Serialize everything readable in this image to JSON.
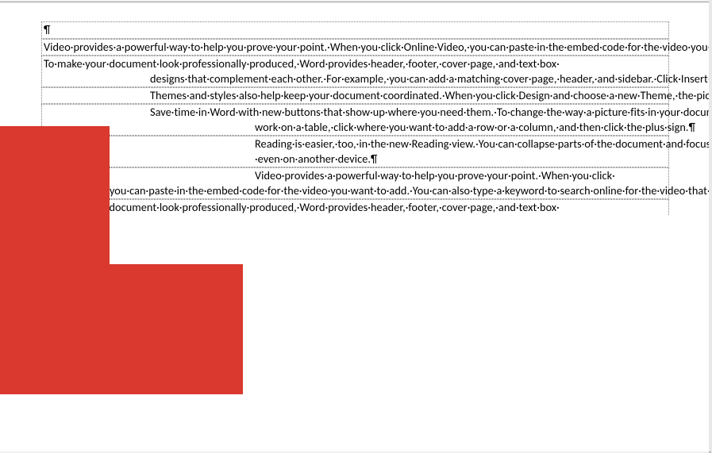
{
  "formatting_marks": {
    "pilcrow": "¶",
    "space_dot": "·"
  },
  "shapes": [
    {
      "type": "rectangle",
      "color": "#d9392e",
      "role": "floating-object"
    }
  ],
  "paragraphs": [
    {
      "id": "empty",
      "text": "",
      "mark": "¶"
    },
    {
      "id": "p1",
      "text": "Video·provides·a·powerful·way·to·help·you·prove·your·point.·When·you·click·Online·Video,·you·can·paste·in·the·embed·code·for·the·video·you·want·to·add.·You·can·also·type·a·keyword·to·search·online·for·the·video·that·best·fits·your·document.¶"
    },
    {
      "id": "p2_a",
      "text": "To·make·your·document·look·professionally·produced,·Word·provides·header,·footer,·cover·page,·and·text·box·"
    },
    {
      "id": "p2_b",
      "text": "designs·that·complement·each·other.·For·example,·you·can·add·a·matching·cover·page,·header,·and·sidebar.·Click·Insert·and·then·choose·the·elements·you·want·from·the·different·galleries.¶"
    },
    {
      "id": "p3",
      "text": "Themes·and·styles·also·help·keep·your·document·coordinated.·When·you·click·Design·and·choose·a·new·Theme,·the·pictures,·charts,·and·SmartArt·graphics·change·to·match·your·new·theme.·When·you·apply·styles,·your·headings·change·to·match·the·new·theme.¶"
    },
    {
      "id": "p4_a",
      "text": "Save·time·in·Word·with·new·buttons·that·show·up·where·you·need·them.·To·change·the·way·a·picture·fits·in·your·document,·click·it·and·a·button·for·layout·options·appears·next·to·it.·When·you·"
    },
    {
      "id": "p4_b",
      "text": "work·on·a·table,·click·where·you·want·to·add·a·row·or·a·column,·and·then·click·the·plus·sign.¶"
    },
    {
      "id": "p5",
      "text": "Reading·is·easier,·too,·in·the·new·Reading·view.·You·can·collapse·parts·of·the·document·and·focus·on·the·text·you·want.·If·you·need·to·stop·reading·before·you·reach·the·end,·Word·remembers·where·you·left·off·-·even·on·another·device.¶"
    },
    {
      "id": "p6_a",
      "text": "Video·provides·a·powerful·way·to·help·you·prove·your·point.·When·you·click·"
    },
    {
      "id": "p6_b",
      "text": "Online·Video,·you·can·paste·in·the·embed·code·for·the·video·you·want·to·add.·You·can·also·type·a·keyword·to·search·online·for·the·video·that·best·fits·your·document.¶"
    },
    {
      "id": "p7",
      "text": "To·make·your·document·look·professionally·produced,·Word·provides·header,·footer,·cover·page,·and·text·box·"
    }
  ]
}
